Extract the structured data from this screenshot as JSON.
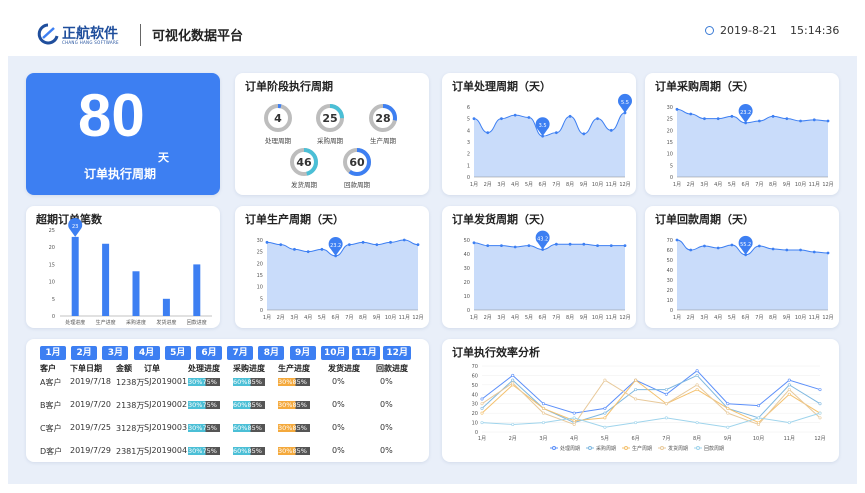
{
  "header": {
    "brand": "正航软件",
    "brand_sub": "CHANG HANG SOFTWARE",
    "title": "可视化数据平台",
    "date": "2019-8-21",
    "time": "15:14:36"
  },
  "big": {
    "value": "80",
    "unit": "天",
    "label": "订单执行周期"
  },
  "stages": {
    "title": "订单阶段执行周期",
    "items": [
      {
        "label": "处理周期",
        "value": "4",
        "pct": 0.04
      },
      {
        "label": "采购周期",
        "value": "25",
        "pct": 0.25
      },
      {
        "label": "生产周期",
        "value": "28",
        "pct": 0.28
      },
      {
        "label": "发货周期",
        "value": "46",
        "pct": 0.46
      },
      {
        "label": "回款周期",
        "value": "60",
        "pct": 0.6
      }
    ]
  },
  "months": [
    "1月",
    "2月",
    "3月",
    "4月",
    "5月",
    "6月",
    "7月",
    "8月",
    "9月",
    "10月",
    "11月",
    "12月"
  ],
  "processing": {
    "title": "订单处理周期（天）",
    "y": [
      5,
      3.8,
      5,
      5.3,
      5.1,
      3.5,
      3.8,
      5.2,
      3.7,
      5,
      4,
      5.5
    ],
    "ylim": [
      0,
      6
    ],
    "ticks": [
      0,
      1,
      2,
      3,
      4,
      5,
      6
    ],
    "pin_min": "3.5",
    "pin_max": "5.5",
    "pin_min_i": 5,
    "pin_max_i": 11
  },
  "purchase": {
    "title": "订单采购周期（天）",
    "y": [
      29,
      27,
      25,
      25,
      26,
      23.2,
      24,
      26,
      25,
      24,
      24.5,
      24
    ],
    "ylim": [
      0,
      30
    ],
    "ticks": [
      0,
      5,
      10,
      15,
      20,
      25,
      30
    ],
    "pin_min": "23.2",
    "pin_max": "",
    "pin_min_i": 5,
    "pin_max_i": 0
  },
  "overdue": {
    "title": "超期订单笔数",
    "categories": [
      "处理进度",
      "生产进度",
      "采购进度",
      "发货进度",
      "回款进度"
    ],
    "values": [
      23,
      21,
      13,
      5,
      15
    ],
    "ylim": [
      0,
      25
    ],
    "ticks": [
      0,
      5,
      10,
      15,
      20,
      25
    ],
    "pin": "23"
  },
  "production": {
    "title": "订单生产周期（天）",
    "y": [
      29,
      28,
      26,
      25,
      26,
      23.2,
      28,
      29,
      28,
      29,
      30,
      28
    ],
    "ylim": [
      0,
      30
    ],
    "ticks": [
      0,
      5,
      10,
      15,
      20,
      25,
      30
    ],
    "pin_min": "23.2",
    "pin_max": "",
    "pin_min_i": 5,
    "pin_max_i": 10
  },
  "shipping": {
    "title": "订单发货周期（天）",
    "y": [
      48,
      46,
      46,
      45,
      46,
      43.2,
      47,
      47,
      47,
      46,
      46,
      46
    ],
    "ylim": [
      0,
      50
    ],
    "ticks": [
      0,
      10,
      20,
      30,
      40,
      50
    ],
    "pin_min": "43.2",
    "pin_max": "",
    "pin_min_i": 5,
    "pin_max_i": 0
  },
  "payment": {
    "title": "订单回款周期（天）",
    "y": [
      70,
      60,
      64,
      62,
      65,
      55.2,
      64,
      61,
      60,
      60,
      58,
      57
    ],
    "ylim": [
      0,
      70
    ],
    "ticks": [
      0,
      10,
      20,
      30,
      40,
      50,
      60,
      70
    ],
    "pin_min": "55.2",
    "pin_max": "",
    "pin_min_i": 5,
    "pin_max_i": 0
  },
  "orders": {
    "headers": [
      "客户",
      "下单日期",
      "金额",
      "订单",
      "处理进度",
      "采购进度",
      "生产进度",
      "发货进度",
      "回款进度"
    ],
    "rows": [
      {
        "customer": "A客户",
        "date": "2019/7/18",
        "amount": "1238万",
        "order": "SJ2019001",
        "proc": "30%75%",
        "purch": "60%85%",
        "prod": "30%85%",
        "ship": "0%",
        "pay": "0%"
      },
      {
        "customer": "B客户",
        "date": "2019/7/20",
        "amount": "2138万",
        "order": "SJ2019002",
        "proc": "30%75%",
        "purch": "60%85%",
        "prod": "30%85%",
        "ship": "0%",
        "pay": "0%"
      },
      {
        "customer": "C客户",
        "date": "2019/7/25",
        "amount": "3128万",
        "order": "SJ2019003",
        "proc": "30%75%",
        "purch": "60%85%",
        "prod": "30%85%",
        "ship": "0%",
        "pay": "0%"
      },
      {
        "customer": "D客户",
        "date": "2019/7/29",
        "amount": "2381万",
        "order": "SJ2019004",
        "proc": "30%75%",
        "purch": "60%85%",
        "prod": "30%85%",
        "ship": "0%",
        "pay": "0%"
      }
    ]
  },
  "efficiency": {
    "title": "订单执行效率分析",
    "ylim": [
      0,
      70
    ],
    "ticks": [
      0,
      10,
      20,
      30,
      40,
      50,
      60,
      70
    ],
    "series": [
      {
        "name": "处理周期",
        "color": "#5b8ff9",
        "values": [
          35,
          60,
          30,
          20,
          25,
          55,
          40,
          65,
          30,
          28,
          55,
          45
        ]
      },
      {
        "name": "采购周期",
        "color": "#7fb8e0",
        "values": [
          25,
          55,
          25,
          10,
          20,
          45,
          45,
          60,
          25,
          15,
          50,
          30
        ]
      },
      {
        "name": "生产周期",
        "color": "#f4c16e",
        "values": [
          20,
          50,
          25,
          12,
          15,
          55,
          30,
          45,
          25,
          10,
          40,
          20
        ]
      },
      {
        "name": "发货周期",
        "color": "#e8c99a",
        "values": [
          30,
          52,
          20,
          8,
          55,
          35,
          30,
          50,
          20,
          8,
          45,
          15
        ]
      },
      {
        "name": "回款周期",
        "color": "#9fd4ec",
        "values": [
          10,
          8,
          10,
          15,
          5,
          10,
          15,
          10,
          5,
          15,
          10,
          20
        ]
      }
    ]
  },
  "colors": {
    "primary": "#3d7ff2",
    "area": "#c9dcfa",
    "line": "#3d7ff2",
    "bg": "#e9eff9",
    "teal": "#4bbfd6",
    "orange": "#f4a93c"
  }
}
